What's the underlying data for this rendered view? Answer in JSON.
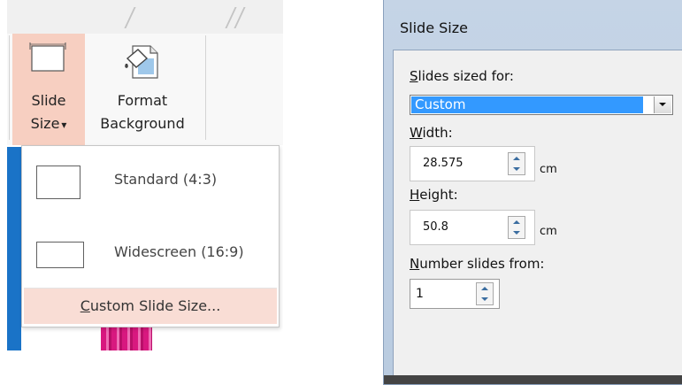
{
  "ribbon": {
    "slide_size": {
      "line1": "Slide",
      "line2": "Size",
      "dropdown_glyph": "▾"
    },
    "format_background": {
      "line1": "Format",
      "line2": "Background"
    }
  },
  "slide_size_menu": {
    "items": [
      {
        "label": "Standard (4:3)",
        "thumb_icon": "standard-4-3-thumbnail-icon"
      },
      {
        "label": "Widescreen (16:9)",
        "thumb_icon": "widescreen-16-9-thumbnail-icon"
      }
    ],
    "custom": {
      "access_key": "C",
      "rest": "ustom Slide Size..."
    }
  },
  "dialog": {
    "title": "Slide Size",
    "sized_for": {
      "label_key": "S",
      "label_rest": "lides sized for:",
      "value": "Custom"
    },
    "width": {
      "label_key": "W",
      "label_rest": "idth:",
      "value": "28.575",
      "unit": "cm"
    },
    "height": {
      "label_key": "H",
      "label_rest": "eight:",
      "value": "50.8",
      "unit": "cm"
    },
    "number_from": {
      "label_key": "N",
      "label_rest": "umber slides from:",
      "value": "1"
    }
  },
  "colors": {
    "ribbon_highlight": "#f7cfc1",
    "menu_highlight": "#f9ddd5",
    "selection_blue": "#3399ff",
    "dialog_frame": "#c5d4e6"
  }
}
